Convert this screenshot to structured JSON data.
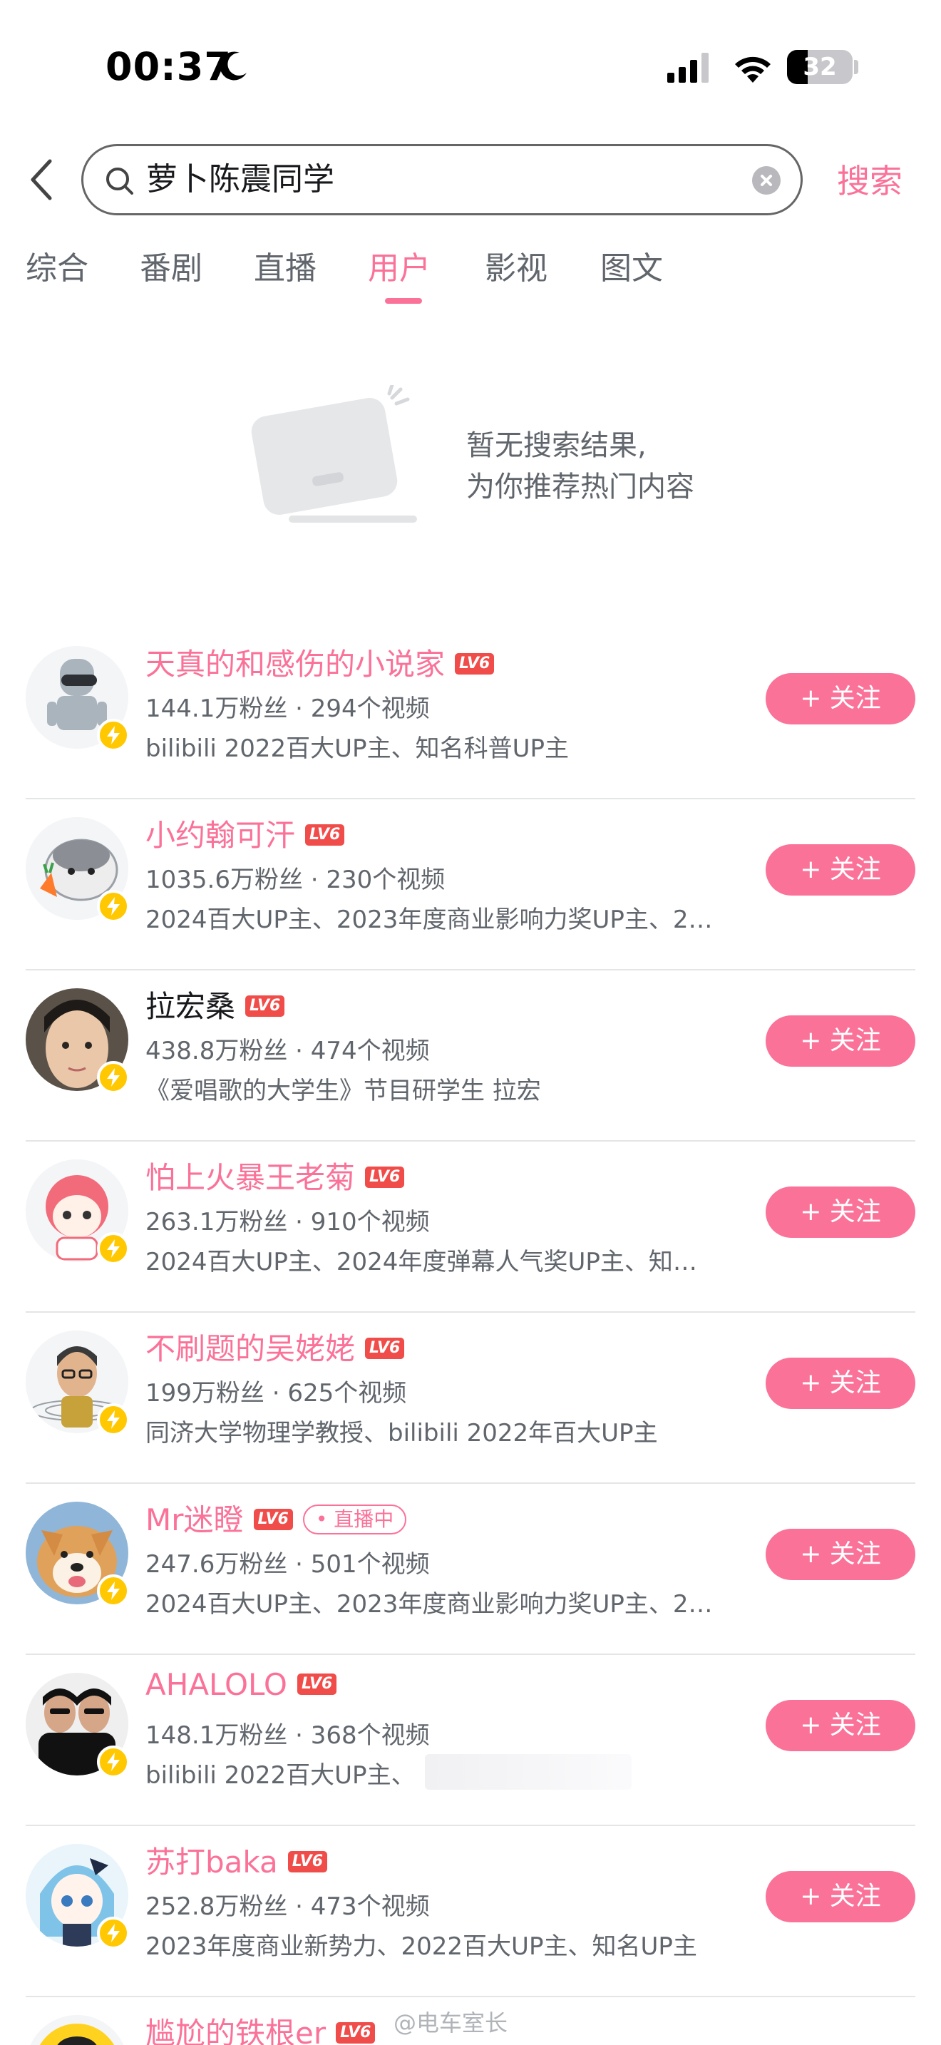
{
  "status_bar": {
    "time": "00:37",
    "battery": "32",
    "battery_level": 0.32
  },
  "search": {
    "query": "萝卜陈震同学",
    "submit_label": "搜索"
  },
  "tabs": [
    {
      "label": "综合",
      "active": false
    },
    {
      "label": "番剧",
      "active": false
    },
    {
      "label": "直播",
      "active": false
    },
    {
      "label": "用户",
      "active": true
    },
    {
      "label": "影视",
      "active": false
    },
    {
      "label": "图文",
      "active": false
    }
  ],
  "empty_state": {
    "line1": "暂无搜索结果,",
    "line2": "为你推荐热门内容"
  },
  "users": [
    {
      "name": "天真的和感伤的小说家",
      "level": "LV6",
      "stats": "144.1万粉丝 · 294个视频",
      "desc": "bilibili 2022百大UP主、知名科普UP主",
      "follow": "+ 关注",
      "name_color": "pink",
      "live": ""
    },
    {
      "name": "小约翰可汗",
      "level": "LV6",
      "stats": "1035.6万粉丝 · 230个视频",
      "desc": "2024百大UP主、2023年度商业影响力奖UP主、2…",
      "follow": "+ 关注",
      "name_color": "pink",
      "live": ""
    },
    {
      "name": "拉宏桑",
      "level": "LV6",
      "stats": "438.8万粉丝 · 474个视频",
      "desc": "《爱唱歌的大学生》节目研学生 拉宏",
      "follow": "+ 关注",
      "name_color": "plain",
      "live": ""
    },
    {
      "name": "怕上火暴王老菊",
      "level": "LV6",
      "stats": "263.1万粉丝 · 910个视频",
      "desc": "2024百大UP主、2024年度弹幕人气奖UP主、知…",
      "follow": "+ 关注",
      "name_color": "pink",
      "live": ""
    },
    {
      "name": "不刷题的吴姥姥",
      "level": "LV6",
      "stats": "199万粉丝 · 625个视频",
      "desc": "同济大学物理学教授、bilibili 2022年百大UP主",
      "follow": "+ 关注",
      "name_color": "pink",
      "live": ""
    },
    {
      "name": "Mr迷瞪",
      "level": "LV6",
      "stats": "247.6万粉丝 · 501个视频",
      "desc": "2024百大UP主、2023年度商业影响力奖UP主、2…",
      "follow": "+ 关注",
      "name_color": "pink",
      "live": "• 直播中"
    },
    {
      "name": "AHALOLO",
      "level": "LV6",
      "stats": "148.1万粉丝 · 368个视频",
      "desc": "bilibili 2022百大UP主、",
      "follow": "+ 关注",
      "name_color": "pink",
      "live": ""
    },
    {
      "name": "苏打baka",
      "level": "LV6",
      "stats": "252.8万粉丝 · 473个视频",
      "desc": "2023年度商业新势力、2022百大UP主、知名UP主",
      "follow": "+ 关注",
      "name_color": "pink",
      "live": ""
    },
    {
      "name": "尴尬的铁根er",
      "level": "LV6",
      "stats": "",
      "desc": "",
      "follow": "",
      "name_color": "pink",
      "live": ""
    }
  ],
  "watermark": "@电车室长",
  "colors": {
    "accent": "#fb7299",
    "level_badge": "#f04c49",
    "verify": "#ffc800"
  },
  "icons": [
    "moon-icon",
    "signal-icon",
    "wifi-icon",
    "battery-icon",
    "back-icon",
    "search-icon",
    "clear-icon",
    "verify-bolt-icon"
  ]
}
